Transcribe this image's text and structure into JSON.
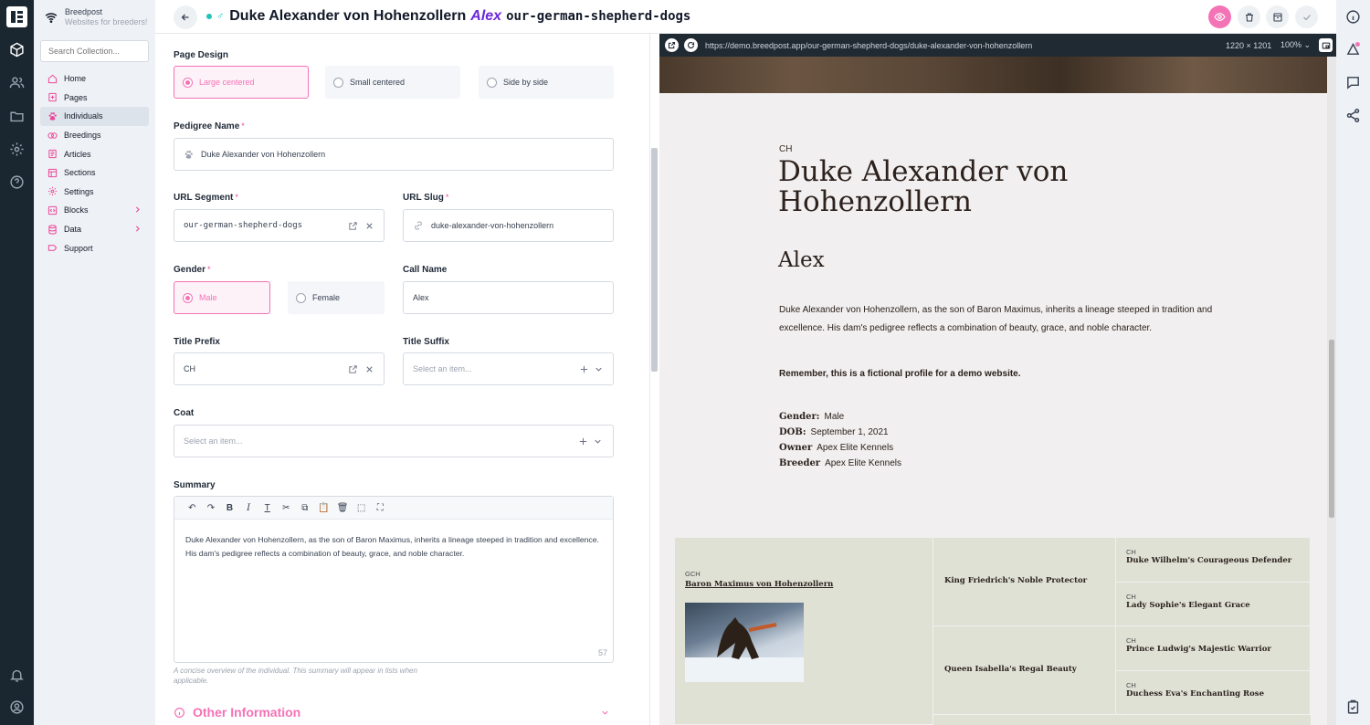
{
  "brand": {
    "name": "Breedpost",
    "tagline": "Websites for breeders!"
  },
  "nav": {
    "search_placeholder": "Search Collection...",
    "items": [
      {
        "label": "Home"
      },
      {
        "label": "Pages"
      },
      {
        "label": "Individuals"
      },
      {
        "label": "Breedings"
      },
      {
        "label": "Articles"
      },
      {
        "label": "Sections"
      },
      {
        "label": "Settings"
      },
      {
        "label": "Blocks"
      },
      {
        "label": "Data"
      },
      {
        "label": "Support"
      }
    ]
  },
  "header": {
    "gender_symbol": "♂",
    "title": "Duke Alexander von Hohenzollern",
    "call_name": "Alex",
    "slug": "our-german-shepherd-dogs"
  },
  "form": {
    "page_design": {
      "label": "Page Design",
      "options": [
        "Large centered",
        "Small centered",
        "Side by side"
      ]
    },
    "pedigree_name": {
      "label": "Pedigree Name",
      "value": "Duke Alexander von Hohenzollern"
    },
    "url_segment": {
      "label": "URL Segment",
      "value": "our-german-shepherd-dogs"
    },
    "url_slug": {
      "label": "URL Slug",
      "value": "duke-alexander-von-hohenzollern"
    },
    "gender": {
      "label": "Gender",
      "options": [
        "Male",
        "Female"
      ]
    },
    "call_name": {
      "label": "Call Name",
      "value": "Alex"
    },
    "title_prefix": {
      "label": "Title Prefix",
      "value": "CH"
    },
    "title_suffix": {
      "label": "Title Suffix",
      "placeholder": "Select an item..."
    },
    "coat": {
      "label": "Coat",
      "placeholder": "Select an item..."
    },
    "summary": {
      "label": "Summary",
      "text": "Duke Alexander von Hohenzollern, as the son of Baron Maximus, inherits a lineage steeped in tradition and excellence. His dam's pedigree reflects a combination of beauty, grace, and noble character.",
      "count": "57",
      "help": "A concise overview of the individual. This summary will appear in lists when applicable."
    },
    "other_information": "Other Information"
  },
  "preview_bar": {
    "url": "https://demo.breedpost.app/our-german-shepherd-dogs/duke-alexander-von-hohenzollern",
    "dimensions": "1220 × 1201",
    "zoom": "100%"
  },
  "preview": {
    "prefix": "CH",
    "name": "Duke Alexander von Hohenzollern",
    "call_name": "Alex",
    "description": "Duke Alexander von Hohenzollern, as the son of Baron Maximus, inherits a lineage steeped in tradition and excellence. His dam's pedigree reflects a combination of beauty, grace, and noble character.",
    "note": "Remember, this is a fictional profile for a demo website.",
    "facts": {
      "gender_label": "Gender:",
      "gender": "Male",
      "dob_label": "DOB:",
      "dob": "September 1, 2021",
      "owner_label": "Owner",
      "owner": "Apex Elite Kennels",
      "breeder_label": "Breeder",
      "breeder": "Apex Elite Kennels"
    },
    "pedigree": {
      "sire_prefix": "GCH",
      "sire": "Baron Maximus von Hohenzollern",
      "grandsire1": "King Friedrich's Noble Protector",
      "granddam1": "Queen Isabella's Regal Beauty",
      "gg1_prefix": "CH",
      "gg1": "Duke Wilhelm's Courageous Defender",
      "gg2_prefix": "CH",
      "gg2": "Lady Sophie's Elegant Grace",
      "gg3_prefix": "CH",
      "gg3": "Prince Ludwig's Majestic Warrior",
      "gg4_prefix": "CH",
      "gg4": "Duchess Eva's Enchanting Rose"
    }
  }
}
